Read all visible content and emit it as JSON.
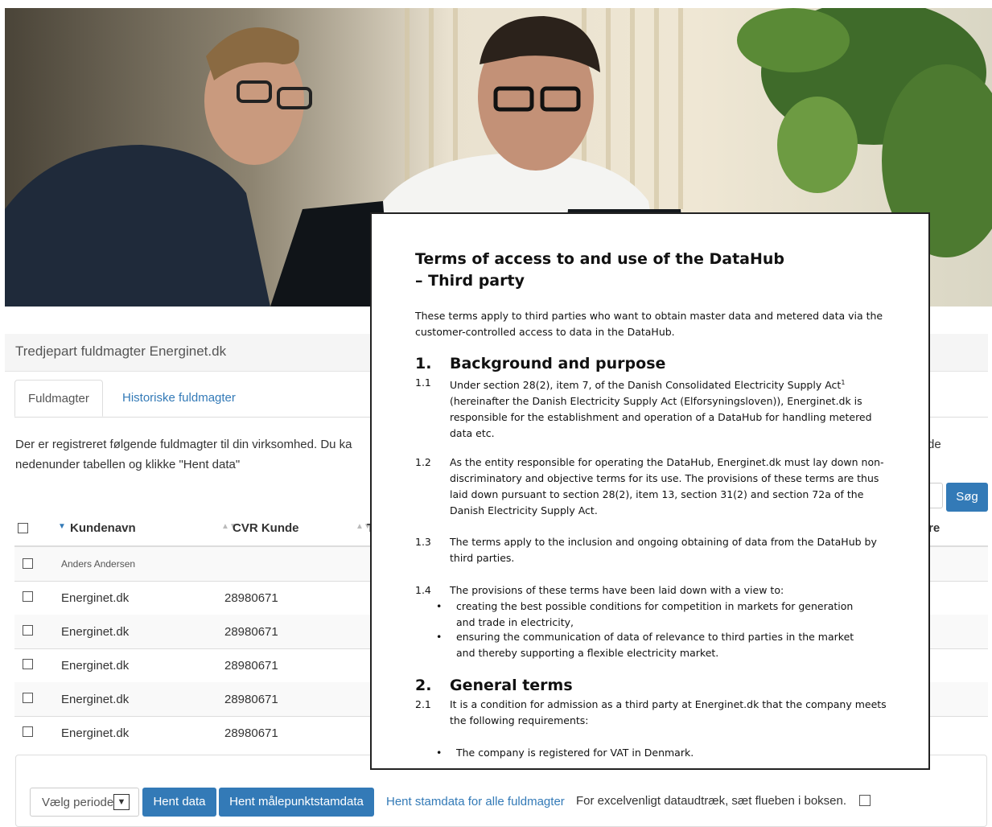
{
  "panel_title": "Tredjepart fuldmagter Energinet.dk",
  "tabs": [
    "Fuldmagter",
    "Historiske fuldmagter"
  ],
  "info": {
    "line1": "Der er registreret følgende fuldmagter til din virksomhed. Du ka",
    "line1_tail": "de",
    "line2": "nedenunder tabellen og klikke \"Hent data\""
  },
  "search_button": "Søg",
  "table": {
    "headers": [
      "Kundenavn",
      "CVR Kunde",
      "T",
      "re"
    ],
    "rows": [
      {
        "name": "Anders Andersen",
        "cvr": ""
      },
      {
        "name": "Energinet.dk",
        "cvr": "28980671"
      },
      {
        "name": "Energinet.dk",
        "cvr": "28980671"
      },
      {
        "name": "Energinet.dk",
        "cvr": "28980671"
      },
      {
        "name": "Energinet.dk",
        "cvr": "28980671"
      },
      {
        "name": "Energinet.dk",
        "cvr": "28980671"
      }
    ]
  },
  "footer": {
    "select_label": "Vælg periode",
    "hent_data": "Hent data",
    "hent_maalepunkt": "Hent målepunktstamdata",
    "hent_stamdata": "Hent stamdata for alle fuldmagter",
    "excel_text": "For excelvenligt dataudtræk, sæt flueben i boksen."
  },
  "document": {
    "title_line1": "Terms of access to and use of the DataHub",
    "title_line2": "– Third party",
    "intro": "These terms apply to third parties who want to obtain master data and metered data via the customer-controlled access to data in the DataHub.",
    "sections": [
      {
        "number": "1.",
        "heading": "Background and purpose",
        "items": [
          {
            "number": "1.1",
            "text": "Under section 28(2), item 7, of the Danish Consolidated Electricity Supply Act",
            "sup": "1",
            "text_rest": " (hereinafter the Danish Electricity Supply Act (Elforsyningsloven)), Energinet.dk is responsible for the establishment and operation of a DataHub for handling metered data etc."
          },
          {
            "number": "1.2",
            "text": "As the entity responsible for operating the DataHub, Energinet.dk must lay down non-discriminatory and objective terms for its use. The provisions of these terms are thus laid down pursuant to section 28(2), item 13, section 31(2) and section 72a of the Danish Electricity Supply Act."
          },
          {
            "number": "1.3",
            "text": "The terms apply to the inclusion and ongoing obtaining of data from the DataHub by third parties."
          },
          {
            "number": "1.4",
            "text": "The provisions of these terms have been laid down with a view to:",
            "bullets": [
              "creating the best possible conditions for competition in markets for generation and trade in electricity,",
              "ensuring the communication of data of relevance to third parties in the market and thereby supporting a flexible electricity market."
            ]
          }
        ]
      },
      {
        "number": "2.",
        "heading": "General terms",
        "items": [
          {
            "number": "2.1",
            "text": "It is a condition for admission as a third party at Energinet.dk that the company meets the following requirements:",
            "bullets": [
              "The company is registered for VAT in Denmark."
            ]
          }
        ]
      }
    ]
  }
}
